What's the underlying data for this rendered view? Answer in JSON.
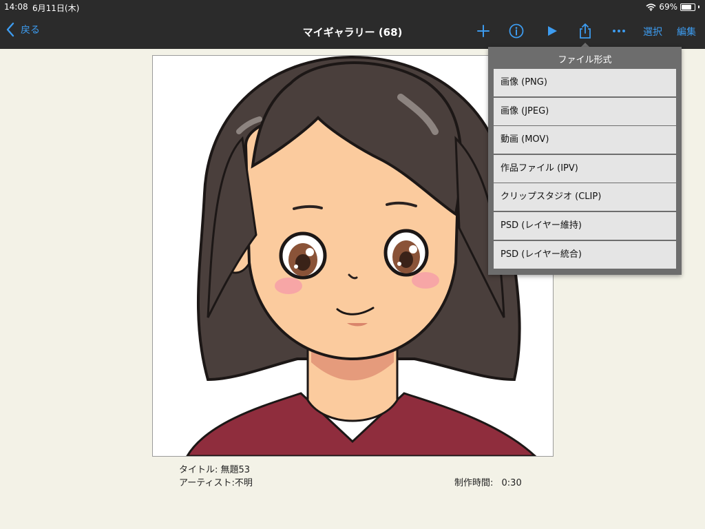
{
  "status_bar": {
    "time": "14:08",
    "date": "6月11日(木)",
    "battery_text": "69%",
    "battery_level": 0.69,
    "icons": [
      "wifi-icon",
      "battery-icon"
    ]
  },
  "nav": {
    "back_label": "戻る",
    "title": "マイギャラリー (68)",
    "select_label": "選択",
    "edit_label": "編集",
    "icons": [
      "back-chevron-icon",
      "plus-icon",
      "info-icon",
      "play-icon",
      "share-icon",
      "more-icon"
    ],
    "accent_color": "#3d9cf0",
    "bar_color": "#2b2b2b"
  },
  "artwork": {
    "title_label": "タイトル: 無題53",
    "artist_label": "アーティスト:不明",
    "time_label": "制作時間:",
    "time_value": "0:30"
  },
  "popover": {
    "title": "ファイル形式",
    "items": [
      "画像 (PNG)",
      "画像 (JPEG)",
      "動画 (MOV)",
      "作品ファイル (IPV)",
      "クリップスタジオ (CLIP)",
      "PSD (レイヤー維持)",
      "PSD (レイヤー統合)"
    ]
  },
  "colors": {
    "background": "#f3f2e7",
    "popover_bg": "#6d6d6d",
    "item_bg": "#e5e5e5"
  }
}
